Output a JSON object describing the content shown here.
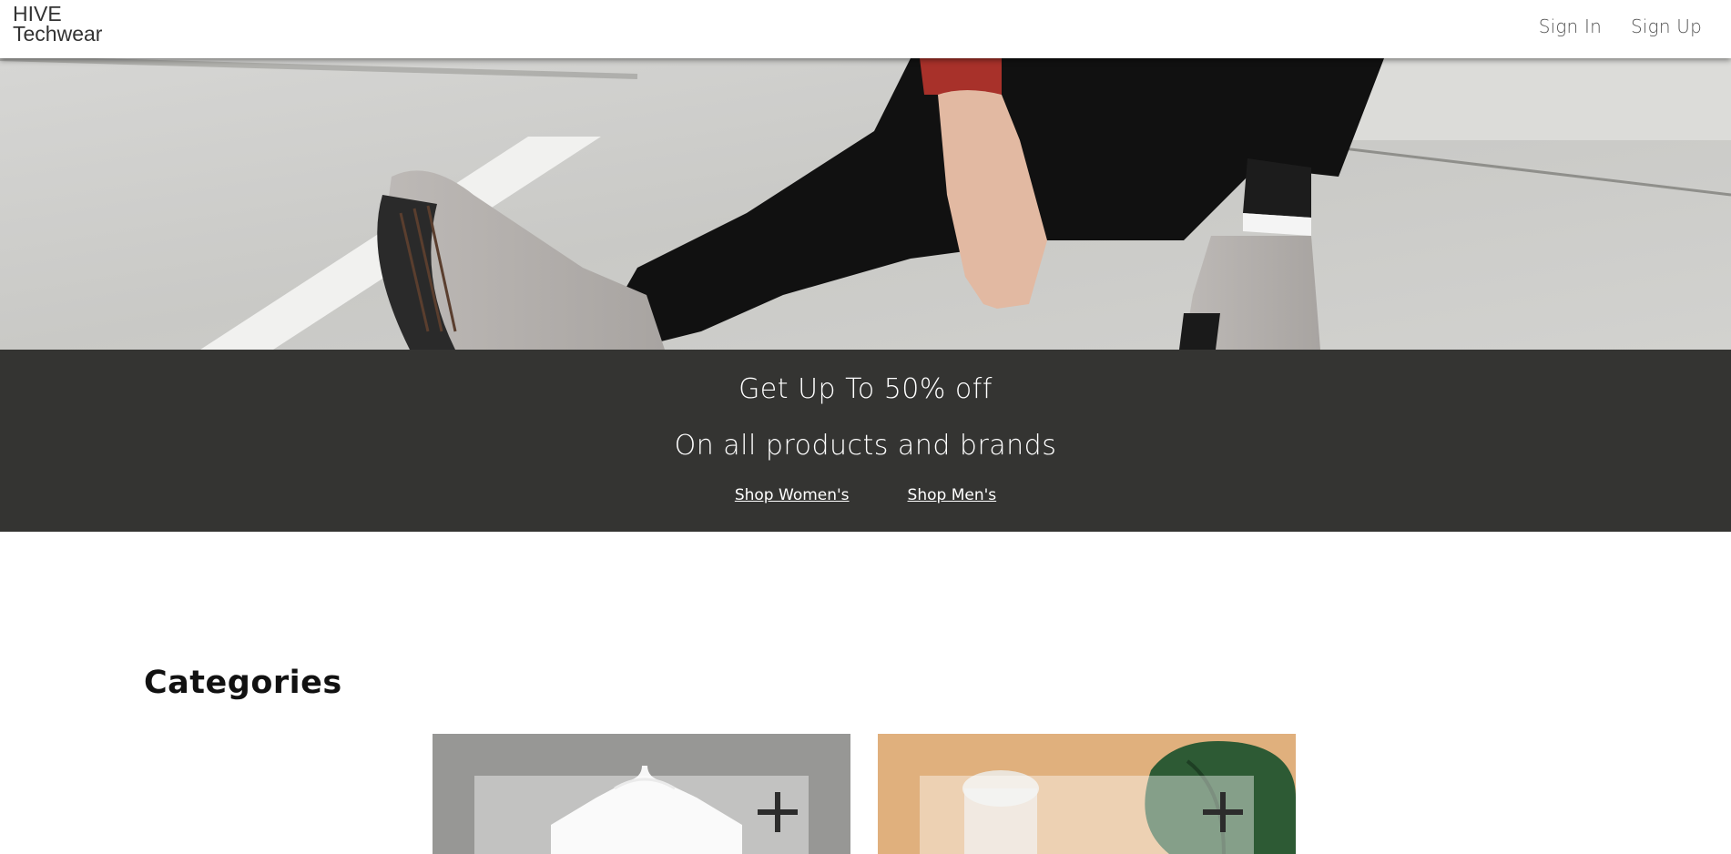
{
  "header": {
    "logo_line1": "HIVE",
    "logo_line2": "Techwear",
    "nav": {
      "sign_in": "Sign In",
      "sign_up": "Sign Up"
    }
  },
  "promo": {
    "headline": "Get Up To 50% off",
    "subheadline": "On all products and brands",
    "links": {
      "women": "Shop Women's",
      "men": "Shop Men's"
    }
  },
  "categories": {
    "title": "Categories"
  },
  "colors": {
    "promo_bg": "#343432",
    "header_bg": "#ffffff",
    "text_dark": "#111111"
  }
}
